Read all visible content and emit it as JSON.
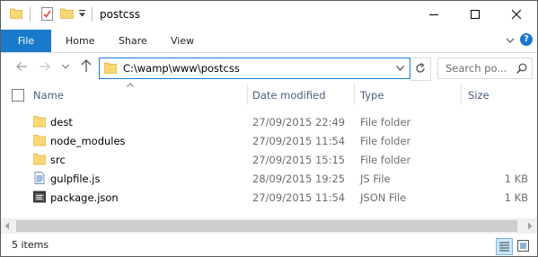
{
  "window": {
    "title": "postcss"
  },
  "ribbon": {
    "tabs": [
      "File",
      "Home",
      "Share",
      "View"
    ],
    "help_label": "?"
  },
  "navigation": {
    "address": "C:\\wamp\\www\\postcss",
    "search_placeholder": "Search po..."
  },
  "columns": {
    "name": "Name",
    "date": "Date modified",
    "type": "Type",
    "size": "Size"
  },
  "files": [
    {
      "name": "dest",
      "date": "27/09/2015 22:49",
      "type": "File folder",
      "size": "",
      "icon": "folder-icon"
    },
    {
      "name": "node_modules",
      "date": "27/09/2015 11:54",
      "type": "File folder",
      "size": "",
      "icon": "folder-icon"
    },
    {
      "name": "src",
      "date": "27/09/2015 15:15",
      "type": "File folder",
      "size": "",
      "icon": "folder-icon"
    },
    {
      "name": "gulpfile.js",
      "date": "28/09/2015 19:25",
      "type": "JS File",
      "size": "1 KB",
      "icon": "js-file-icon"
    },
    {
      "name": "package.json",
      "date": "27/09/2015 11:54",
      "type": "JSON File",
      "size": "1 KB",
      "icon": "json-file-icon"
    }
  ],
  "status": {
    "item_count": "5 items"
  },
  "colors": {
    "accent": "#1979ca",
    "folder": "#f8d775",
    "folder_dark": "#e0b03d",
    "header_text": "#4c607a"
  }
}
